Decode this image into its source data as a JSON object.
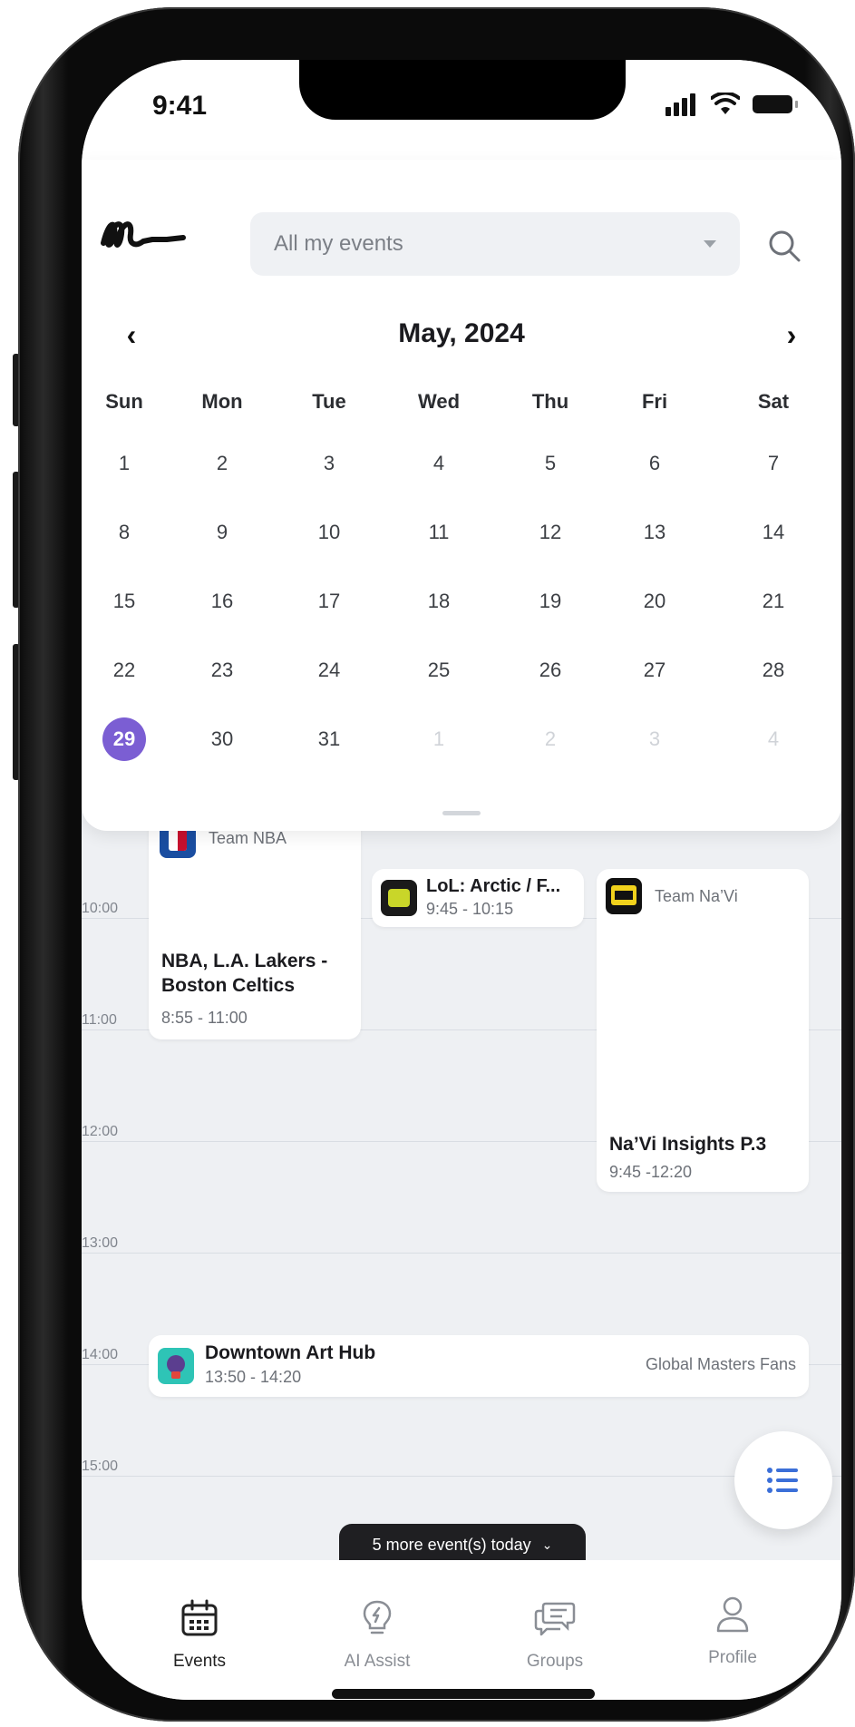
{
  "status_bar": {
    "time": "9:41"
  },
  "header": {
    "logo": "ell",
    "filter": {
      "value": "All my events"
    }
  },
  "calendar": {
    "month_title": "May, 2024",
    "weekdays": [
      "Sun",
      "Mon",
      "Tue",
      "Wed",
      "Thu",
      "Fri",
      "Sat"
    ],
    "weeks": [
      [
        "1",
        "2",
        "3",
        "4",
        "5",
        "6",
        "7"
      ],
      [
        "8",
        "9",
        "10",
        "11",
        "12",
        "13",
        "14"
      ],
      [
        "15",
        "16",
        "17",
        "18",
        "19",
        "20",
        "21"
      ],
      [
        "22",
        "23",
        "24",
        "25",
        "26",
        "27",
        "28"
      ],
      [
        "29",
        "30",
        "31",
        "1",
        "2",
        "3",
        "4"
      ]
    ],
    "selected_day": "29",
    "accent_color": "#7b5ed3"
  },
  "timeline": {
    "hours": [
      "10:00",
      "11:00",
      "12:00",
      "13:00",
      "14:00",
      "15:00"
    ],
    "events": [
      {
        "source": "Team NBA",
        "title": "NBA, L.A. Lakers - Boston Celtics",
        "time": "8:55 - 11:00",
        "icon": "nba-logo-icon"
      },
      {
        "title": "LoL: Arctic / F...",
        "time": "9:45 - 10:15",
        "icon": "esports-team-icon"
      },
      {
        "source": "Team Na’Vi",
        "title": "Na’Vi Insights P.3",
        "time": "9:45 -12:20",
        "icon": "navi-logo-icon"
      },
      {
        "title": "Downtown Art Hub",
        "time": "13:50 - 14:20",
        "group": "Global Masters Fans",
        "icon": "art-hub-icon"
      }
    ]
  },
  "more_events": {
    "label": "5 more event(s) today"
  },
  "tabbar": {
    "tabs": [
      {
        "label": "Events",
        "icon": "calendar-icon",
        "active": true
      },
      {
        "label": "AI Assist",
        "icon": "lightbulb-icon",
        "active": false
      },
      {
        "label": "Groups",
        "icon": "chat-bubbles-icon",
        "active": false
      },
      {
        "label": "Profile",
        "icon": "person-icon",
        "active": false
      }
    ]
  }
}
